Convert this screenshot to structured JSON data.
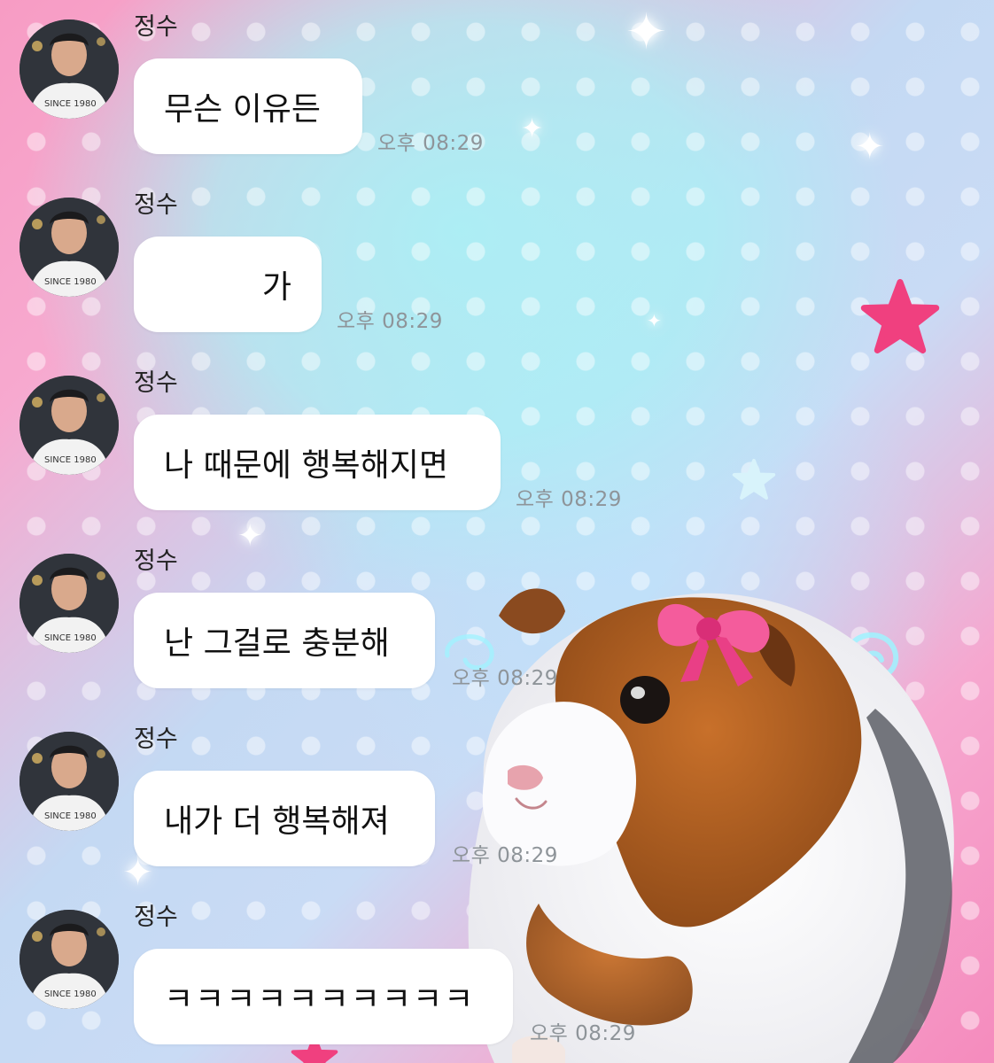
{
  "colors": {
    "bubble": "#ffffff",
    "timestamp": "#8e9499",
    "name": "#222222",
    "star_pink": "#f0407f",
    "star_blue": "#bfe9f7"
  },
  "messages": [
    {
      "sender": "정수",
      "text": "무슨 이유든",
      "time": "오후 08:29"
    },
    {
      "sender": "정수",
      "text": "가",
      "time": "오후 08:29"
    },
    {
      "sender": "정수",
      "text": "나 때문에 행복해지면",
      "time": "오후 08:29"
    },
    {
      "sender": "정수",
      "text": "난 그걸로 충분해",
      "time": "오후 08:29"
    },
    {
      "sender": "정수",
      "text": "내가 더 행복해져",
      "time": "오후 08:29"
    },
    {
      "sender": "정수",
      "text": "ㅋㅋㅋㅋㅋㅋㅋㅋㅋㅋ",
      "time": "오후 08:29"
    }
  ],
  "avatar": {
    "shirt_text": "SINCE 1980"
  },
  "decorations": [
    "sparkle-icon",
    "star-icon",
    "swirl-icon",
    "guinea-pig-sticker",
    "bow-icon"
  ]
}
